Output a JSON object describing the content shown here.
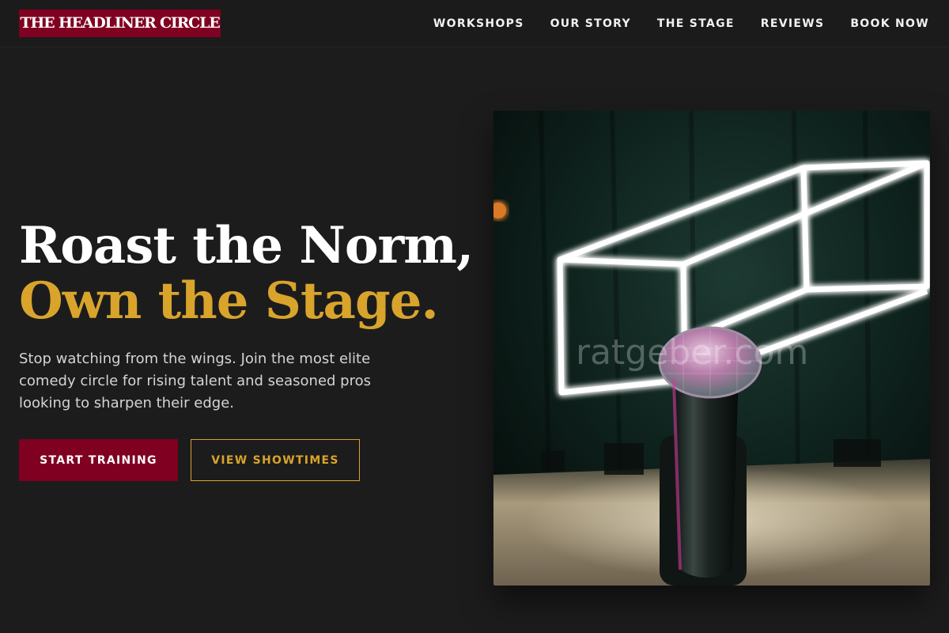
{
  "brand": {
    "logo_text": "THE HEADLINER CIRCLE"
  },
  "nav": {
    "links": [
      {
        "label": "WORKSHOPS"
      },
      {
        "label": "OUR STORY"
      },
      {
        "label": "THE STAGE"
      },
      {
        "label": "REVIEWS"
      },
      {
        "label": "BOOK NOW"
      }
    ]
  },
  "hero": {
    "headline_line1": "Roast the Norm,",
    "headline_line2": "Own the Stage.",
    "description": "Stop watching from the wings. Join the most elite comedy circle for rising talent and seasoned pros looking to sharpen their edge.",
    "primary_cta": "START TRAINING",
    "secondary_cta": "VIEW SHOWTIMES",
    "image": {
      "subject": "microphone-neon-stage-photo",
      "watermark": "ratgeber.com"
    }
  },
  "colors": {
    "background": "#1c1c1c",
    "brand_crimson": "#7f0020",
    "accent_gold": "#d9a42c",
    "text_primary": "#ffffff",
    "text_muted": "#d4d4d4"
  }
}
